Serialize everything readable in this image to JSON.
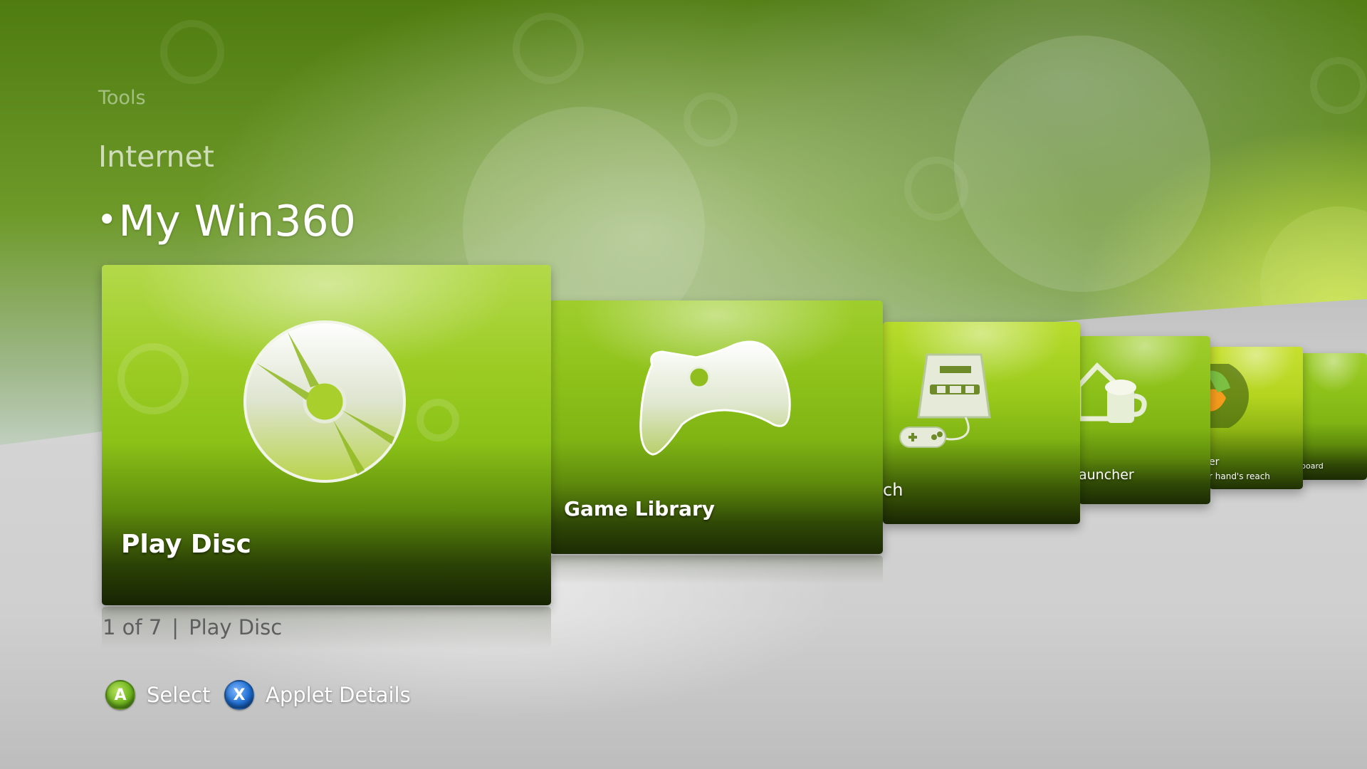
{
  "nav": {
    "tools": "Tools",
    "internet": "Internet",
    "current": "My Win360",
    "bullet": "•"
  },
  "tiles": [
    {
      "label": "Play Disc",
      "icon": "disc-icon"
    },
    {
      "label": "Game Library",
      "icon": "controller-icon"
    },
    {
      "label": "ch",
      "icon": "retro-console-icon"
    },
    {
      "label": "auncher",
      "icon": "house-beer-icon"
    },
    {
      "label": "er",
      "sub": "r hand's reach",
      "icon": "globe-logo-icon"
    },
    {
      "label": "board",
      "icon": "tile-icon"
    }
  ],
  "status": {
    "position": "1 of 7",
    "separator": "|",
    "name": "Play Disc"
  },
  "hints": [
    {
      "button": "A",
      "label": "Select",
      "color": "#6fb51f"
    },
    {
      "button": "X",
      "label": "Applet Details",
      "color": "#1f6fd1"
    }
  ],
  "colors": {
    "tile_green": "#8ec21a",
    "accent": "#9fce2c"
  }
}
